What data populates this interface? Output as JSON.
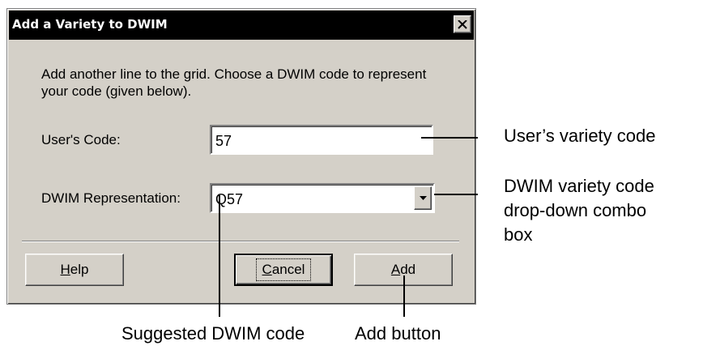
{
  "dialog": {
    "title": "Add a Variety to DWIM",
    "message": "Add another line to the grid.  Choose a DWIM code to represent your code (given below).",
    "users_code_label": "User's Code:",
    "users_code_value": "57",
    "dwim_label": "DWIM Representation:",
    "dwim_value": "Q57",
    "buttons": {
      "help": "Help",
      "help_mnemonic": "H",
      "help_rest": "elp",
      "cancel": "Cancel",
      "cancel_mnemonic": "C",
      "cancel_rest": "ancel",
      "add": "Add",
      "add_mnemonic": "A",
      "add_rest": "dd"
    }
  },
  "annotations": {
    "users_variety_code": "User’s variety code",
    "dwim_variety_code_line1": "DWIM variety code",
    "dwim_variety_code_line2": "drop-down combo",
    "dwim_variety_code_line3": "box",
    "suggested_dwim_code": "Suggested DWIM code",
    "add_button": "Add button"
  },
  "icons": {
    "close": "close-icon",
    "dropdown": "chevron-down-icon"
  }
}
